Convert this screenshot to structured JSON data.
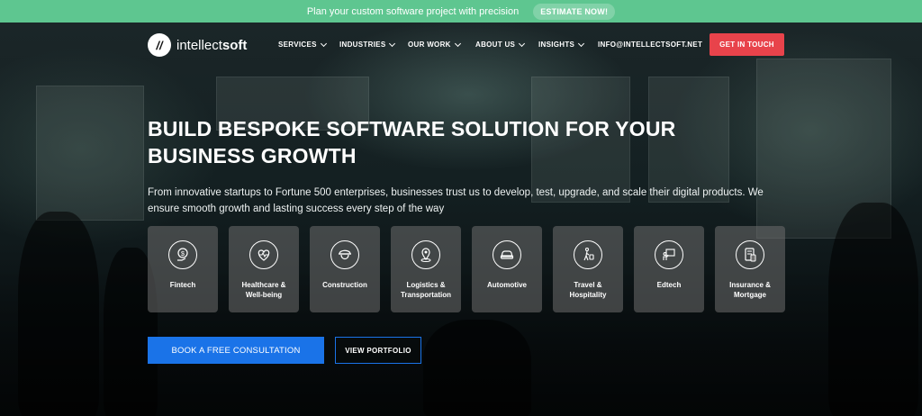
{
  "promo_bar": {
    "text": "Plan your custom software project with precision",
    "button_label": "ESTIMATE NOW!"
  },
  "header": {
    "logo_mark": "//",
    "logo_text_regular": "intellect",
    "logo_text_bold": "soft",
    "menu": [
      {
        "label": "SERVICES",
        "has_dropdown": true
      },
      {
        "label": "INDUSTRIES",
        "has_dropdown": true
      },
      {
        "label": "OUR WORK",
        "has_dropdown": true
      },
      {
        "label": "ABOUT US",
        "has_dropdown": true
      },
      {
        "label": "INSIGHTS",
        "has_dropdown": true
      },
      {
        "label": "INFO@INTELLECTSOFT.NET",
        "has_dropdown": false
      }
    ],
    "cta_label": "GET IN TOUCH"
  },
  "hero": {
    "headline": "BUILD BESPOKE SOFTWARE SOLUTION FOR YOUR BUSINESS GROWTH",
    "subline": "From innovative startups to Fortune 500 enterprises, businesses trust us to develop, test, upgrade, and scale their digital products. We ensure smooth growth and lasting success every step of the way"
  },
  "industries": [
    {
      "label": "Fintech",
      "icon": "dollar-hand-icon"
    },
    {
      "label": "Healthcare & Well-being",
      "icon": "heart-pulse-icon"
    },
    {
      "label": "Construction",
      "icon": "hard-hat-worker-icon"
    },
    {
      "label": "Logistics & Transportation",
      "icon": "map-pin-icon"
    },
    {
      "label": "Automotive",
      "icon": "car-icon"
    },
    {
      "label": "Travel & Hospitality",
      "icon": "traveler-luggage-icon"
    },
    {
      "label": "Edtech",
      "icon": "presentation-board-icon"
    },
    {
      "label": "Insurance & Mortgage",
      "icon": "document-phone-icon"
    }
  ],
  "actions": {
    "primary_label": "BOOK A FREE CONSULTATION",
    "secondary_label": "VIEW PORTFOLIO"
  },
  "colors": {
    "promo_bg": "#5ec690",
    "cta_red": "#e8434b",
    "primary_blue": "#1a73e8",
    "card_bg": "#6e6e6e"
  }
}
